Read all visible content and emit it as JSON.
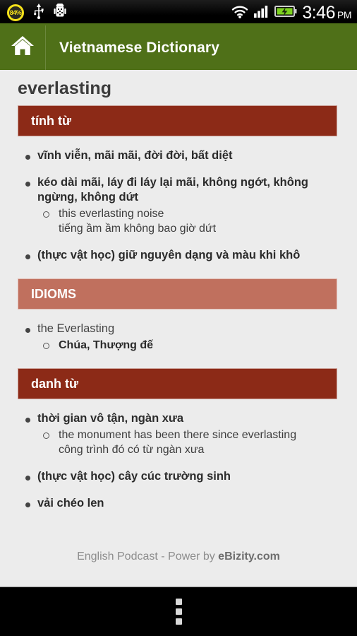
{
  "statusbar": {
    "battery_percent_label": "84%",
    "battery_icon": "battery-percent-circle-icon",
    "usb_icon": "usb-icon",
    "android_icon": "android-robot-icon",
    "wifi_icon": "wifi-icon",
    "signal_icon": "cellular-signal-icon",
    "battery_charging_icon": "battery-charging-icon",
    "time": "3:46",
    "ampm": "PM"
  },
  "actionbar": {
    "home_icon": "home-icon",
    "title": "Vietnamese Dictionary"
  },
  "entry": {
    "word": "everlasting",
    "sections": [
      {
        "id": "adjective",
        "label": "tính từ",
        "style": "pos",
        "entries": [
          {
            "text": "vĩnh viễn, mãi mãi, đời đời, bất diệt",
            "bold": true,
            "subs": []
          },
          {
            "text": "kéo dài mãi, láy đi láy lại mãi, không ngớt, không ngừng, không dứt",
            "bold": true,
            "subs": [
              {
                "en": "this everlasting noise",
                "vi": "tiếng ầm ầm không bao giờ dứt",
                "bold": false
              }
            ]
          },
          {
            "text": "(thực vật học) giữ nguyên dạng và màu khi khô",
            "bold": true,
            "subs": []
          }
        ]
      },
      {
        "id": "idioms",
        "label": "IDIOMS",
        "style": "idiom",
        "entries": [
          {
            "text": "the Everlasting",
            "bold": false,
            "subs": [
              {
                "en": "Chúa, Thượng đế",
                "vi": "",
                "bold": true
              }
            ]
          }
        ]
      },
      {
        "id": "noun",
        "label": "danh từ",
        "style": "pos",
        "entries": [
          {
            "text": "thời gian vô tận, ngàn xưa",
            "bold": true,
            "subs": [
              {
                "en": "the monument has been there since everlasting",
                "vi": "công trình đó có từ ngàn xưa",
                "bold": false
              }
            ]
          },
          {
            "text": "(thực vật học) cây cúc trường sinh",
            "bold": true,
            "subs": []
          },
          {
            "text": "vải chéo len",
            "bold": true,
            "subs": []
          }
        ]
      }
    ]
  },
  "footer": {
    "prefix": "English Podcast - Power by ",
    "brand": "eBizity.com"
  },
  "navbar": {
    "overflow_icon": "overflow-menu-icon"
  },
  "colors": {
    "accent_green": "#4f7018",
    "pos_banner": "#8c2a17",
    "idiom_banner": "#c0705e",
    "page_bg": "#ececec"
  }
}
